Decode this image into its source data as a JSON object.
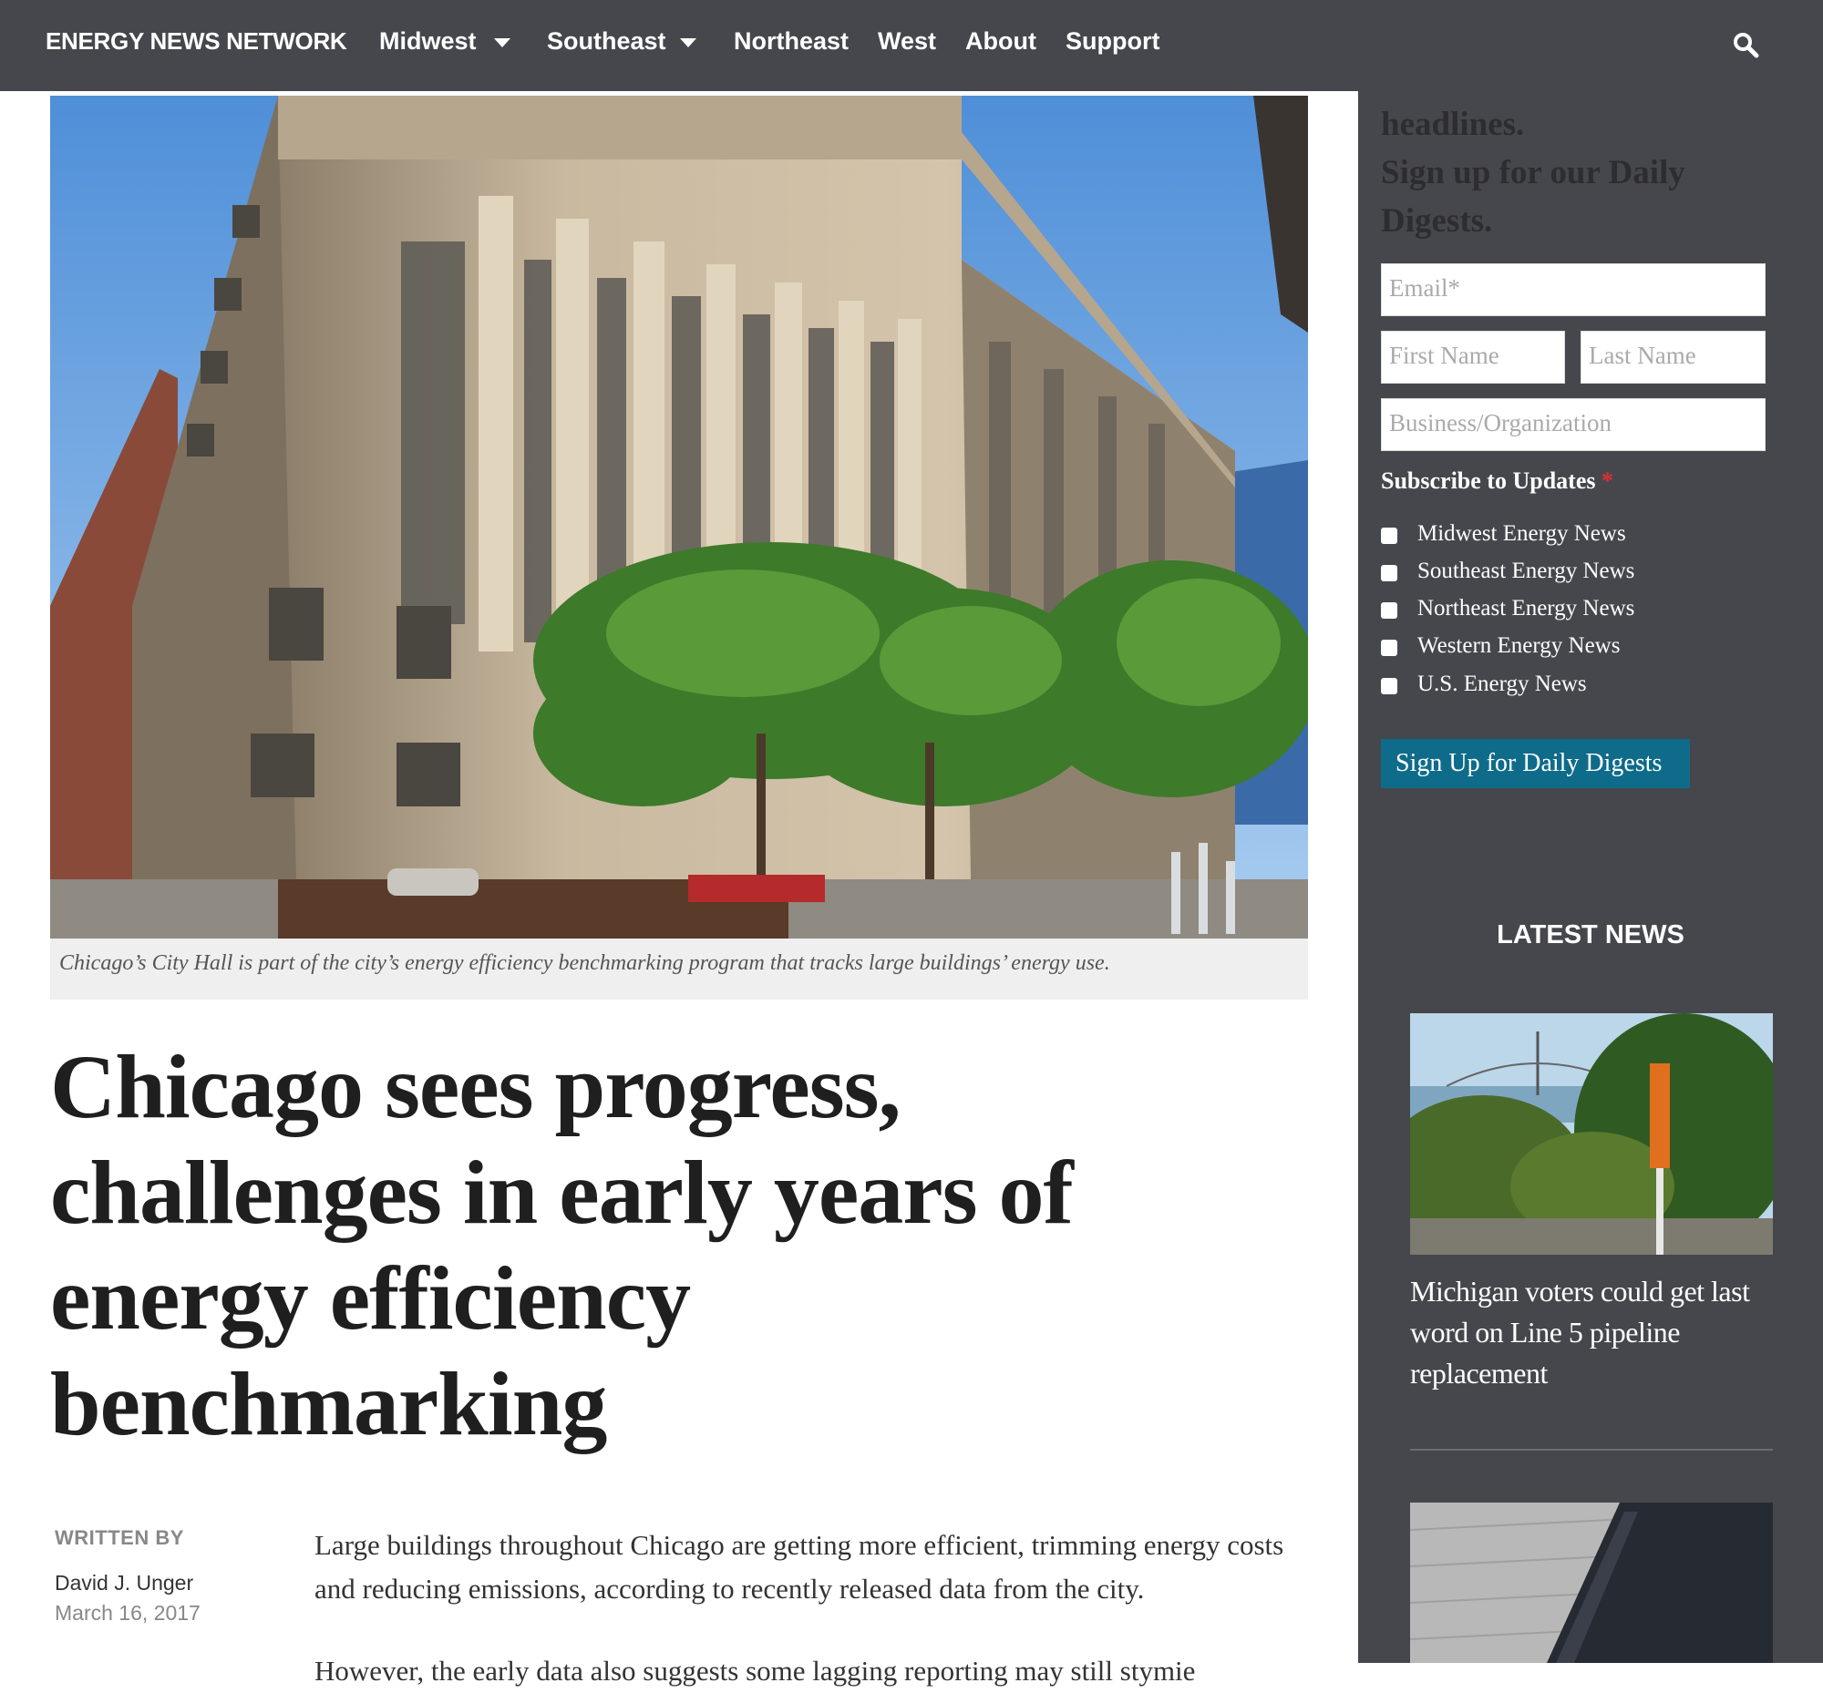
{
  "nav": {
    "brand": "ENERGY NEWS NETWORK",
    "items": [
      "Midwest",
      "Southeast",
      "Northeast",
      "West",
      "About",
      "Support"
    ]
  },
  "hero": {
    "caption": "Chicago’s City Hall is part of the city’s energy efficiency benchmarking program that tracks large buildings’ energy use."
  },
  "article": {
    "headline_lines": [
      "Chicago sees progress,",
      "challenges in early years of",
      "energy efficiency",
      "benchmarking"
    ],
    "byline_label": "WRITTEN BY",
    "author": "David J. Unger",
    "date": "March 16, 2017",
    "paragraph": "Large buildings throughout Chicago are getting more efficient, trimming energy costs and reducing emissions, according to recently released data from the city.",
    "paragraph2": "However, the early data also suggests some lagging reporting may still stymie"
  },
  "sidebar": {
    "signup_lines": [
      "headlines.",
      "Sign up for our Daily",
      "Digests."
    ],
    "email_placeholder": "Email*",
    "first_name_placeholder": "First Name",
    "last_name_placeholder": "Last Name",
    "org_placeholder": "Business/Organization",
    "subscribe_label": "Subscribe to Updates",
    "required_mark": "*",
    "options": [
      "Midwest Energy News",
      "Southeast Energy News",
      "Northeast Energy News",
      "Western Energy News",
      "U.S. Energy News"
    ],
    "button_label": "Sign Up for Daily Digests",
    "latest_heading": "LATEST NEWS",
    "news_title": "Michigan voters could get last word on Line 5 pipeline replacement"
  },
  "colors": {
    "nav_bg": "#46474c",
    "sidebar_bg": "#46474c",
    "button_bg": "#0f6b8a"
  }
}
